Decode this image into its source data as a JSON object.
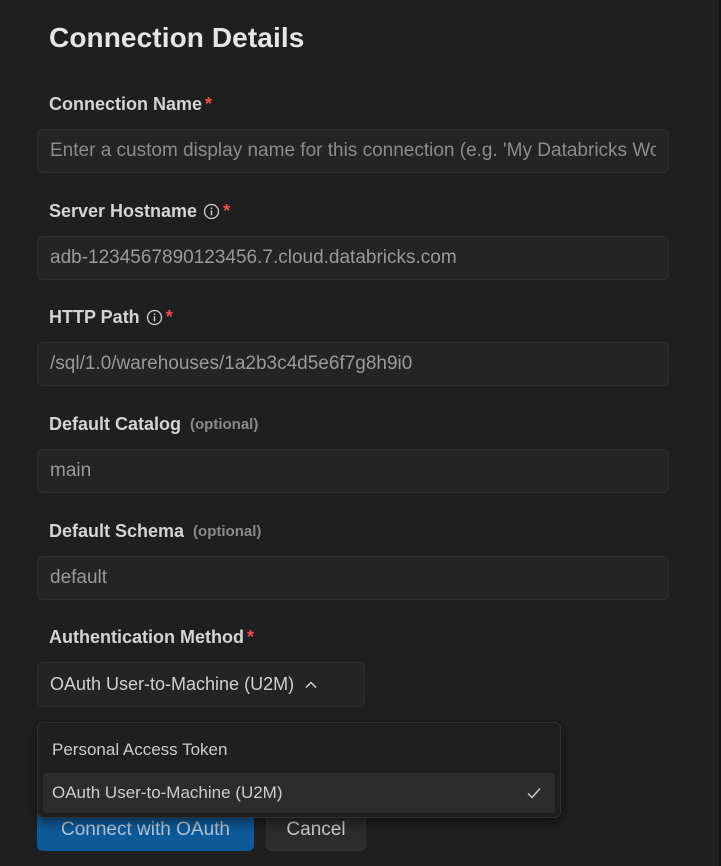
{
  "page": {
    "title": "Connection Details"
  },
  "fields": {
    "connection_name": {
      "label": "Connection Name",
      "required_mark": "*",
      "placeholder": "Enter a custom display name for this connection (e.g. 'My Databricks Workspace')",
      "value": ""
    },
    "server_hostname": {
      "label": "Server Hostname",
      "info_icon": "info-icon",
      "required_mark": "*",
      "value": "adb-1234567890123456.7.cloud.databricks.com"
    },
    "http_path": {
      "label": "HTTP Path",
      "info_icon": "info-icon",
      "required_mark": "*",
      "value": "/sql/1.0/warehouses/1a2b3c4d5e6f7g8h9i0"
    },
    "default_catalog": {
      "label": "Default Catalog",
      "optional_hint": "(optional)",
      "value": "main"
    },
    "default_schema": {
      "label": "Default Schema",
      "optional_hint": "(optional)",
      "value": "default"
    }
  },
  "auth": {
    "label": "Authentication Method",
    "required_mark": "*",
    "selected": "OAuth User-to-Machine (U2M)",
    "chevron_icon": "chevron-up-icon",
    "options": [
      {
        "label": "Personal Access Token",
        "selected": false
      },
      {
        "label": "OAuth User-to-Machine (U2M)",
        "selected": true,
        "check_icon": "check-icon"
      }
    ]
  },
  "actions": {
    "connect_label": "Connect with OAuth",
    "cancel_label": "Cancel"
  },
  "colors": {
    "background": "#1f1f1f",
    "input_bg": "#242424",
    "required": "#f14c4c",
    "primary_button": "#0e5a98",
    "selected_option_bg": "#2c2c2c"
  }
}
